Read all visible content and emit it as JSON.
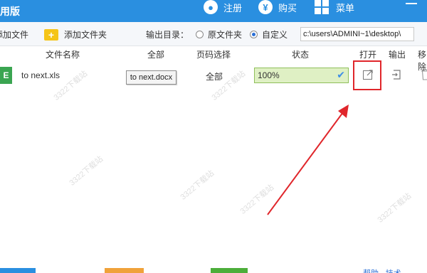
{
  "titlebar": {
    "title_fragment": "用版",
    "register_label": "注册",
    "buy_label": "购买",
    "menu_label": "菜单"
  },
  "toolbar": {
    "add_file_label": "添加文件",
    "add_folder_label": "添加文件夹",
    "output_dir_label": "输出目录：",
    "original_folder_label": "原文件夹",
    "custom_label": "自定义",
    "output_path": "c:\\users\\ADMINI~1\\desktop\\"
  },
  "columns": {
    "file_name": "文件名称",
    "all": "全部",
    "page_select": "页码选择",
    "status": "状态",
    "open": "打开",
    "output": "输出",
    "remove": "移除"
  },
  "row": {
    "file_name": "to next.xls",
    "target_format": "to next.docx",
    "pages": "全部",
    "progress": "100%",
    "progress_value": 1.0,
    "status_icon": "check-icon"
  },
  "icons": {
    "open": "open-external-icon",
    "output": "export-icon",
    "remove": "trash-icon",
    "register": "user-icon",
    "buy": "yen-icon",
    "menu": "grid-menu-icon",
    "add_folder": "folder-plus-icon"
  },
  "bottom": {
    "link_label": "帮助 · 技术"
  },
  "watermark_text": "3322下载站",
  "colors": {
    "titlebar": "#2a8fe0",
    "highlight": "#e0262b",
    "progress_bg": "#dff0c4",
    "excel_green": "#3aa551"
  }
}
